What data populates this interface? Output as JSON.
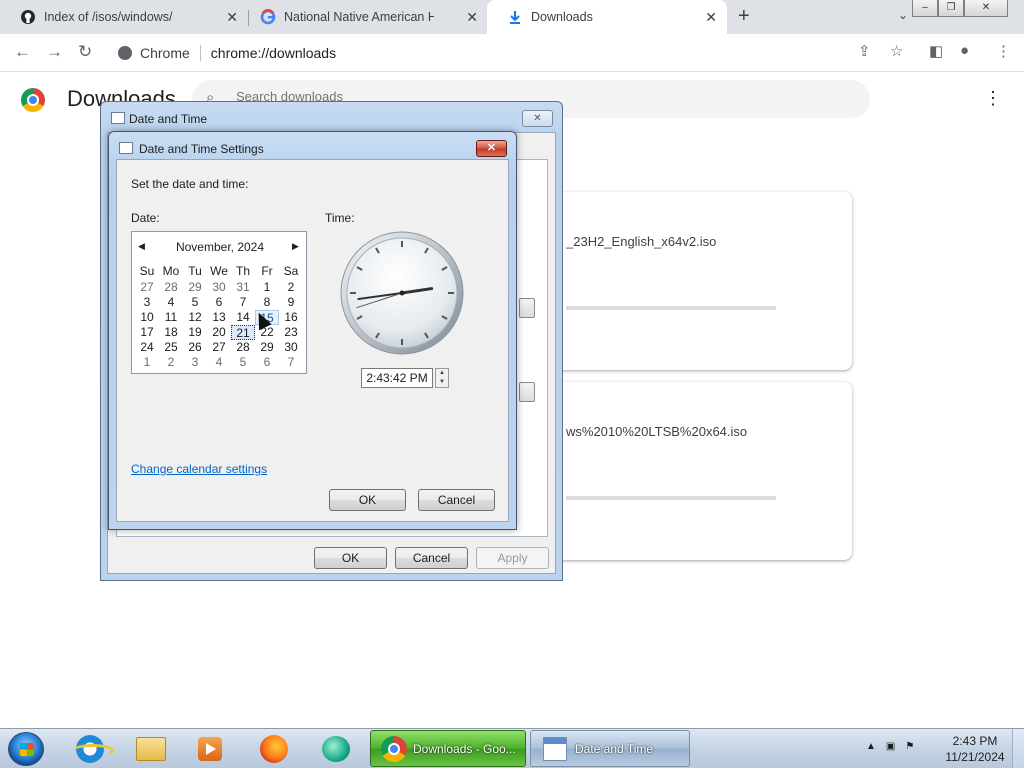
{
  "browser": {
    "tabs": [
      {
        "title": "Index of /isos/windows/",
        "icon": "github-icon"
      },
      {
        "title": "National Native American Herita",
        "icon": "google-icon"
      },
      {
        "title": "Downloads",
        "icon": "download-icon"
      }
    ],
    "omnibox": {
      "chip": "Chrome",
      "url": "chrome://downloads"
    }
  },
  "downloads": {
    "title": "Downloads",
    "search_placeholder": "Search downloads",
    "items": [
      {
        "filename": "_23H2_English_x64v2.iso"
      },
      {
        "filename": "ws%2010%20LTSB%20x64.iso"
      }
    ]
  },
  "date_time_dialog": {
    "title": "Date and Time",
    "ok": "OK",
    "cancel": "Cancel",
    "apply": "Apply"
  },
  "settings_dialog": {
    "title": "Date and Time Settings",
    "instruction": "Set the date and time:",
    "date_label": "Date:",
    "time_label": "Time:",
    "calendar": {
      "month_year": "November, 2024",
      "weekdays": [
        "Su",
        "Mo",
        "Tu",
        "We",
        "Th",
        "Fr",
        "Sa"
      ],
      "weeks": [
        [
          "27",
          "28",
          "29",
          "30",
          "31",
          "1",
          "2"
        ],
        [
          "3",
          "4",
          "5",
          "6",
          "7",
          "8",
          "9"
        ],
        [
          "10",
          "11",
          "12",
          "13",
          "14",
          "15",
          "16"
        ],
        [
          "17",
          "18",
          "19",
          "20",
          "21",
          "22",
          "23"
        ],
        [
          "24",
          "25",
          "26",
          "27",
          "28",
          "29",
          "30"
        ],
        [
          "1",
          "2",
          "3",
          "4",
          "5",
          "6",
          "7"
        ]
      ],
      "selected_day": "21",
      "today_day": "15"
    },
    "time_value": "2:43:42 PM",
    "calendar_link": "Change calendar settings",
    "ok": "OK",
    "cancel": "Cancel"
  },
  "taskbar": {
    "tasks": [
      {
        "label": "Downloads - Goo..."
      },
      {
        "label": "Date and Time"
      }
    ],
    "clock_time": "2:43 PM",
    "clock_date": "11/21/2024"
  }
}
